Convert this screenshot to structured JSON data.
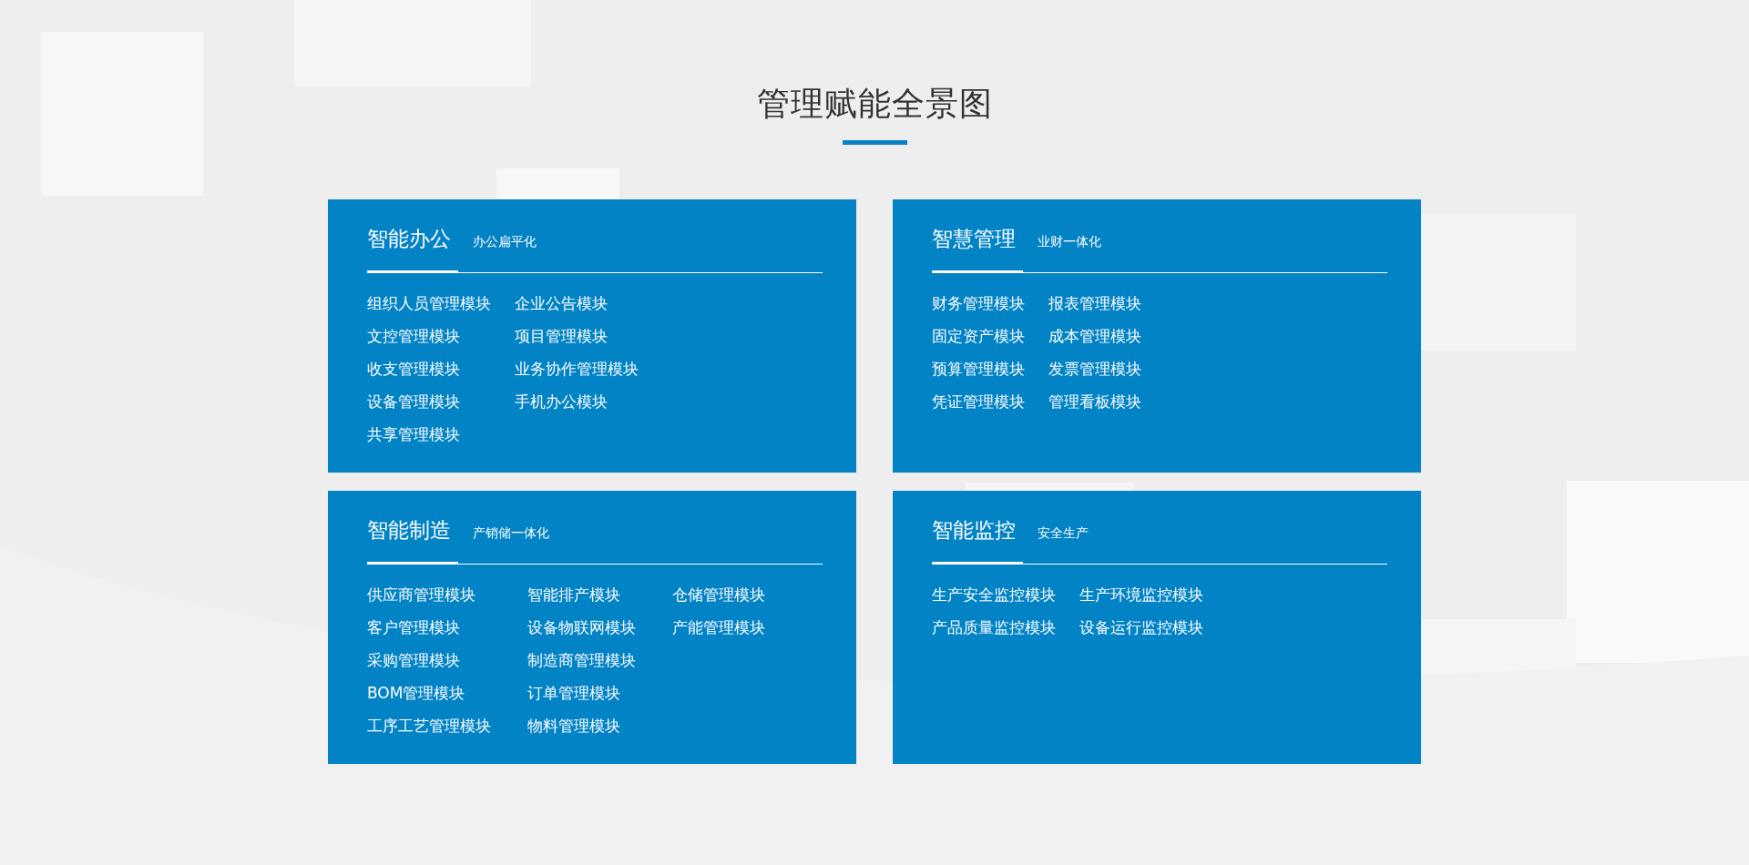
{
  "title": "管理赋能全景图",
  "cards": [
    {
      "title": "智能办公",
      "subtitle": "办公扁平化",
      "rows": [
        [
          "组织人员管理模块",
          "企业公告模块"
        ],
        [
          "文控管理模块",
          "项目管理模块"
        ],
        [
          "收支管理模块",
          "业务协作管理模块"
        ],
        [
          "设备管理模块",
          "手机办公模块"
        ],
        [
          "共享管理模块"
        ]
      ]
    },
    {
      "title": "智慧管理",
      "subtitle": "业财一体化",
      "rows": [
        [
          "财务管理模块",
          "报表管理模块"
        ],
        [
          "固定资产模块",
          "成本管理模块"
        ],
        [
          "预算管理模块",
          "发票管理模块"
        ],
        [
          "凭证管理模块",
          "管理看板模块"
        ]
      ]
    },
    {
      "title": "智能制造",
      "subtitle": "产销储一体化",
      "rows": [
        [
          "供应商管理模块",
          "智能排产模块",
          "仓储管理模块"
        ],
        [
          "客户管理模块",
          "设备物联网模块",
          "产能管理模块"
        ],
        [
          "采购管理模块",
          "制造商管理模块"
        ],
        [
          "BOM管理模块",
          "订单管理模块"
        ],
        [
          "工序工艺管理模块",
          "物料管理模块"
        ]
      ]
    },
    {
      "title": "智能监控",
      "subtitle": "安全生产",
      "rows": [
        [
          "生产安全监控模块",
          "生产环境监控模块"
        ],
        [
          "产品质量监控模块",
          "设备运行监控模块"
        ]
      ]
    }
  ]
}
